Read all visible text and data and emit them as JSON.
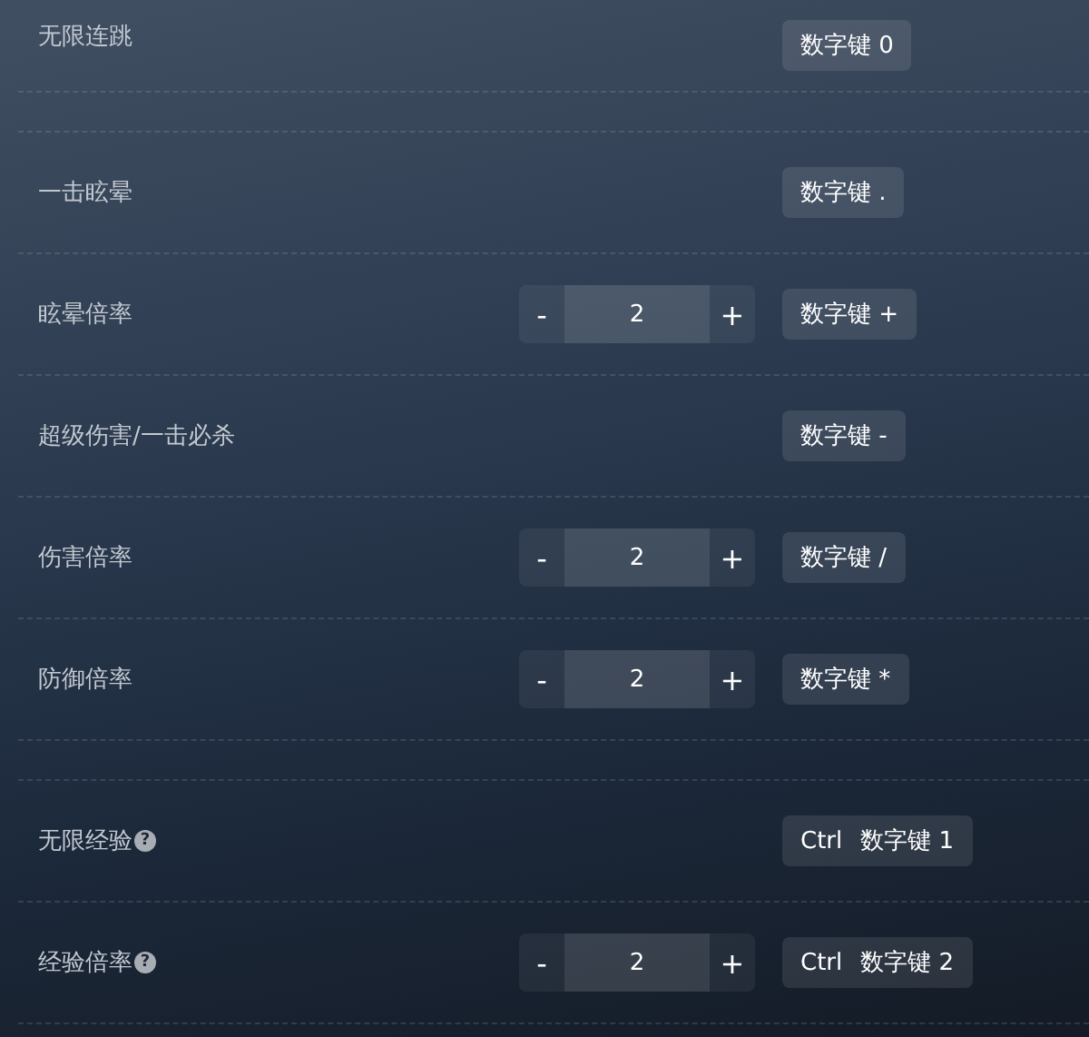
{
  "items": [
    {
      "kind": "row",
      "label": "无限连跳",
      "keys": [
        "数字键 0"
      ]
    },
    {
      "kind": "spacer"
    },
    {
      "kind": "row",
      "label": "一击眩晕",
      "keys": [
        "数字键 ."
      ]
    },
    {
      "kind": "row",
      "label": "眩晕倍率",
      "stepper": {
        "minus": "-",
        "value": "2",
        "plus": "+"
      },
      "keys": [
        "数字键 +"
      ]
    },
    {
      "kind": "row",
      "label": "超级伤害/一击必杀",
      "keys": [
        "数字键 -"
      ]
    },
    {
      "kind": "row",
      "label": "伤害倍率",
      "stepper": {
        "minus": "-",
        "value": "2",
        "plus": "+"
      },
      "keys": [
        "数字键 /"
      ]
    },
    {
      "kind": "row",
      "label": "防御倍率",
      "stepper": {
        "minus": "-",
        "value": "2",
        "plus": "+"
      },
      "keys": [
        "数字键 *"
      ]
    },
    {
      "kind": "spacer"
    },
    {
      "kind": "row",
      "label": "无限经验",
      "help": "?",
      "keys": [
        "Ctrl",
        "数字键 1"
      ]
    },
    {
      "kind": "row",
      "label": "经验倍率",
      "help": "?",
      "stepper": {
        "minus": "-",
        "value": "2",
        "plus": "+"
      },
      "keys": [
        "Ctrl",
        "数字键 2"
      ]
    }
  ]
}
